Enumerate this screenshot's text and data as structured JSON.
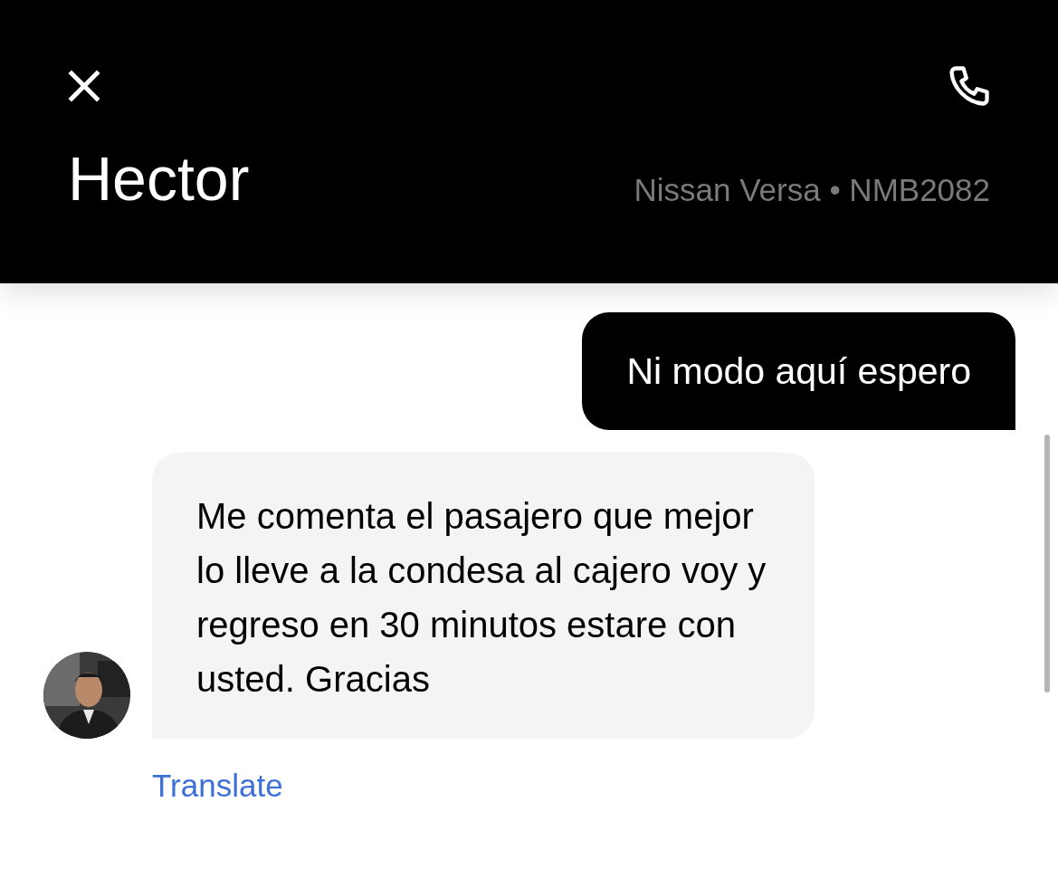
{
  "header": {
    "title": "Hector",
    "vehicle": "Nissan Versa • NMB2082"
  },
  "messages": [
    {
      "kind": "outgoing",
      "text": "Ni modo aquí espero"
    },
    {
      "kind": "incoming",
      "text": "Me comenta el pasajero que mejor lo lleve a la condesa al cajero voy y regreso en 30 minutos estare con usted. Gracias",
      "translate": "Translate"
    }
  ]
}
